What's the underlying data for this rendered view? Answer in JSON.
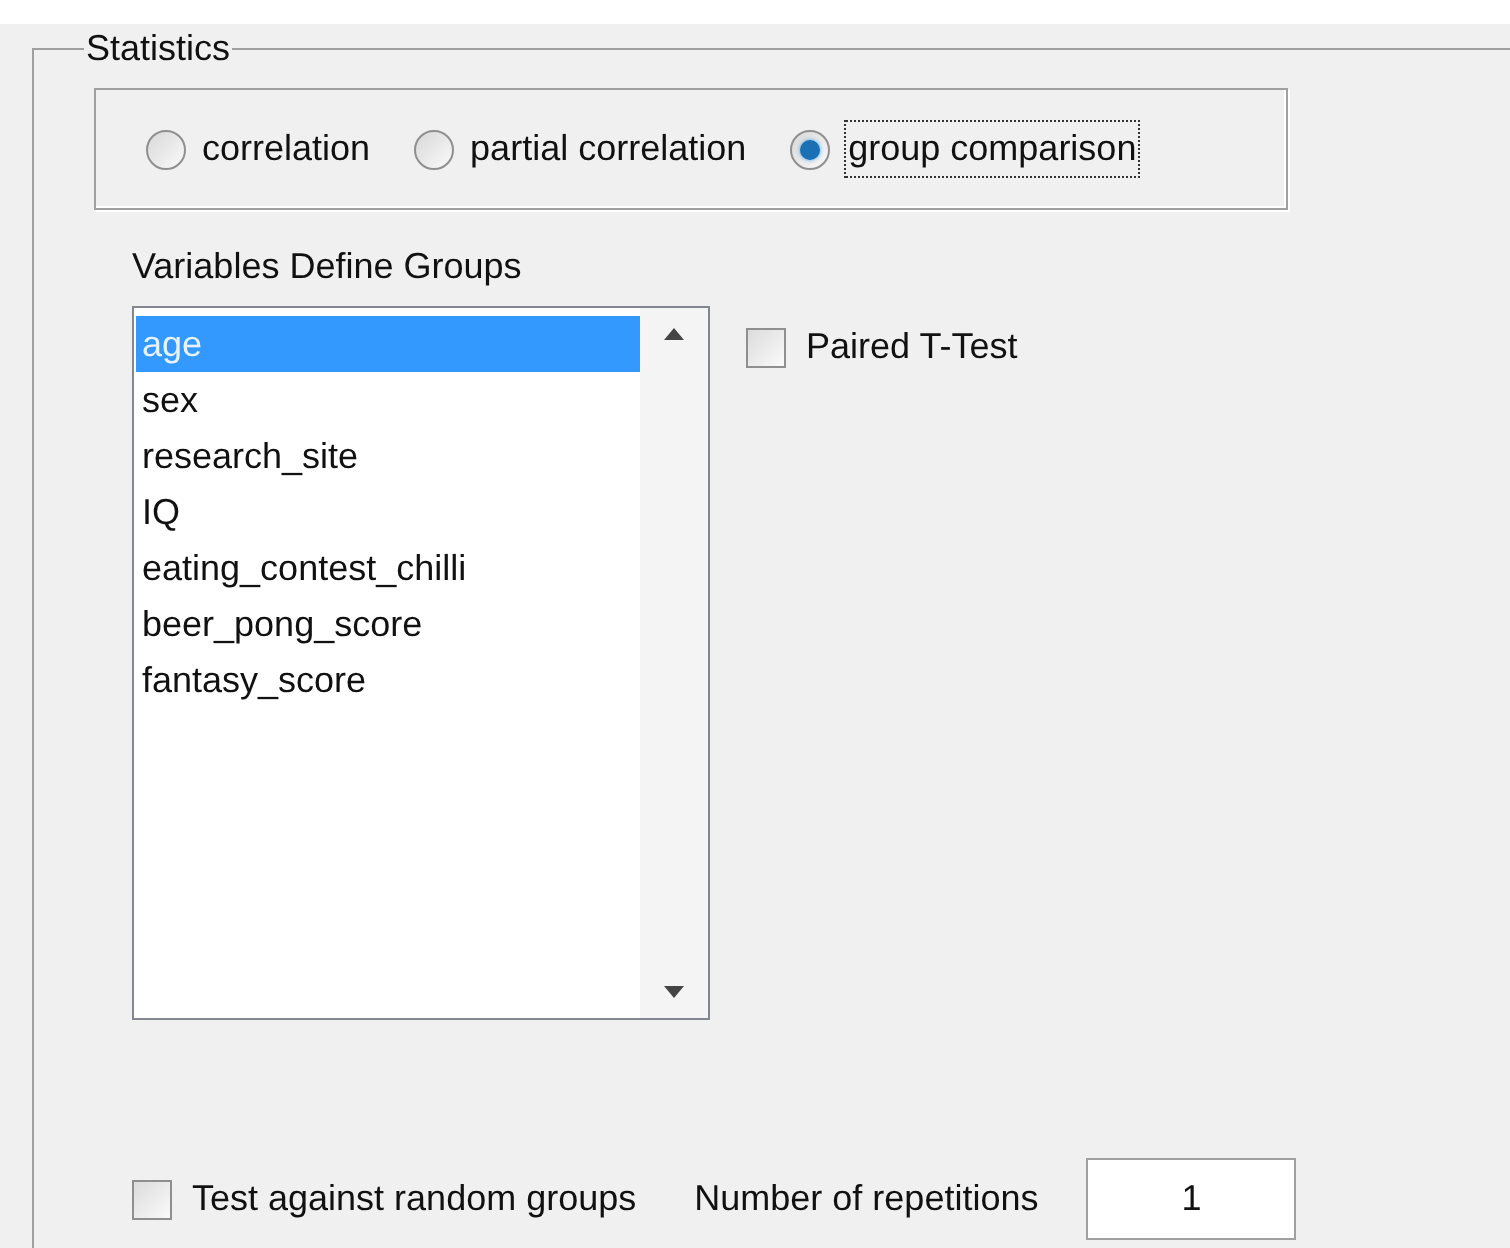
{
  "group_title": "Statistics",
  "modes": [
    {
      "label": "correlation",
      "selected": false
    },
    {
      "label": "partial correlation",
      "selected": false
    },
    {
      "label": "group comparison",
      "selected": true
    }
  ],
  "variables_label": "Variables Define Groups",
  "variables": [
    {
      "label": "age",
      "selected": true
    },
    {
      "label": "sex",
      "selected": false
    },
    {
      "label": "research_site",
      "selected": false
    },
    {
      "label": "IQ",
      "selected": false
    },
    {
      "label": "eating_contest_chilli",
      "selected": false
    },
    {
      "label": "beer_pong_score",
      "selected": false
    },
    {
      "label": "fantasy_score",
      "selected": false
    }
  ],
  "paired_t_test": {
    "label": "Paired T-Test",
    "checked": false
  },
  "random_groups": {
    "label": "Test against random groups",
    "checked": false
  },
  "repetitions": {
    "label": "Number of repetitions",
    "value": "1"
  }
}
